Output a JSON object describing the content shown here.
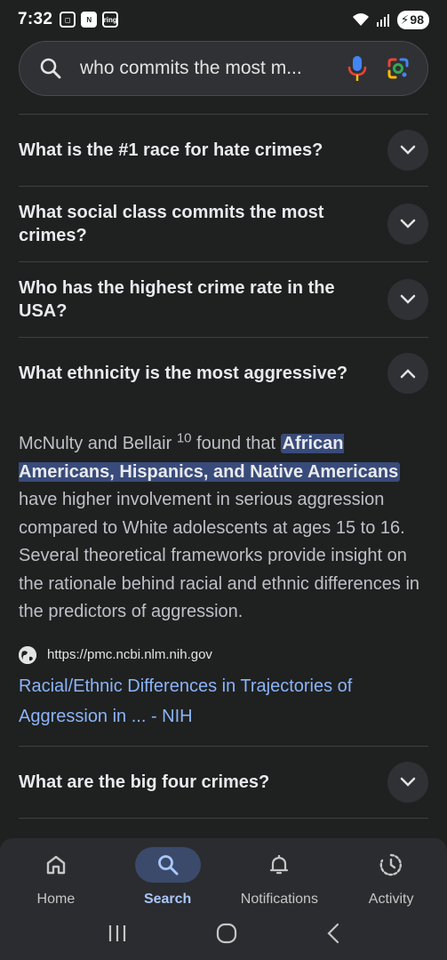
{
  "status": {
    "time": "7:32",
    "icon_labels": [
      "ring"
    ],
    "battery": "98"
  },
  "search": {
    "query": "who commits the most m..."
  },
  "faq": [
    {
      "question": "What is the #1 race for hate crimes?",
      "expanded": false
    },
    {
      "question": "What social class commits the most crimes?",
      "expanded": false
    },
    {
      "question": "Who has the highest crime rate in the USA?",
      "expanded": false
    },
    {
      "question": "What ethnicity is the most aggressive?",
      "expanded": true
    }
  ],
  "answer": {
    "lead": "McNulty and Bellair ",
    "sup": "10",
    "after_sup": " found that ",
    "highlight": "African Americans, Hispanics, and Native Americans",
    "rest": " have higher involvement in serious aggression compared to White adolescents at ages 15 to 16. Several theoretical frameworks provide insight on the rationale behind racial and ethnic differences in the predictors of aggression.",
    "source_url": "https://pmc.ncbi.nlm.nih.gov",
    "source_title": "Racial/Ethnic Differences in Trajectories of Aggression in ... - NIH"
  },
  "faq_more": {
    "question": "What are the big four crimes?"
  },
  "bottom_nav": [
    {
      "label": "Home",
      "icon": "home-icon",
      "active": false
    },
    {
      "label": "Search",
      "icon": "search-icon",
      "active": true
    },
    {
      "label": "Notifications",
      "icon": "bell-icon",
      "active": false
    },
    {
      "label": "Activity",
      "icon": "activity-icon",
      "active": false
    }
  ],
  "colors": {
    "background": "#1f2020",
    "link": "#8ab4f8",
    "highlight": "#394b7a",
    "active_nav": "#a8c7fa"
  }
}
